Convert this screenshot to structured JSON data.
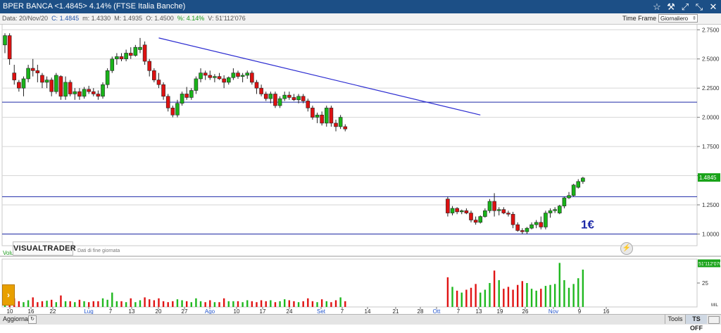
{
  "titlebar": {
    "title": "BPER BANCA <1.4845> 4.14%  (FTSE Italia Banche)",
    "icons": [
      "star-icon",
      "hammer-icon",
      "expand-icon",
      "collapse-icon",
      "close-icon"
    ]
  },
  "infobar": {
    "date": "Data: 20/Nov/20",
    "close": "C: 1.4845",
    "min": "m: 1.4330",
    "max": "M: 1.4935",
    "open": "O: 1.4500",
    "pct": "%: 4.14%",
    "volume": "V: 51'112'076",
    "timeframe_label": "Time Frame",
    "timeframe_value": "Giornaliero"
  },
  "watermark": {
    "brand": "VISUALTRADER",
    "sub": "Dati di fine giornata"
  },
  "statusbar": {
    "update": "Aggiorna",
    "tools": "Tools",
    "ts": "TS OFF"
  },
  "annotation": "1€",
  "chart_data": {
    "type": "candlestick",
    "price_axis": {
      "min": 0.9,
      "max": 2.8,
      "ticks": [
        2.75,
        2.5,
        2.25,
        2.0,
        1.75,
        1.5,
        1.25,
        1.0
      ],
      "tick_labels": [
        "2.7500",
        "2.5000",
        "2.2500",
        "2.0000",
        "1.7500",
        "1.5000",
        "1.2500",
        "1.0000"
      ]
    },
    "last_price_label": "1.4845",
    "date_labels": [
      "10",
      "16",
      "22",
      "Lug",
      "7",
      "13",
      "20",
      "27",
      "Ago",
      "10",
      "17",
      "24",
      "Set",
      "7",
      "14",
      "21",
      "28",
      "Ott",
      "7",
      "13",
      "19",
      "26",
      "Nov",
      "9",
      "16"
    ],
    "hlines": [
      2.13,
      1.32,
      1.0
    ],
    "trendline": {
      "from": {
        "bar": 33,
        "price": 2.68
      },
      "to": {
        "bar": 102,
        "price": 2.02
      }
    },
    "candles_segment_1": [
      [
        2.62,
        2.72,
        2.55,
        2.7
      ],
      [
        2.7,
        2.72,
        2.45,
        2.5
      ],
      [
        2.38,
        2.45,
        2.28,
        2.32
      ],
      [
        2.3,
        2.32,
        2.22,
        2.25
      ],
      [
        2.25,
        2.35,
        2.18,
        2.33
      ],
      [
        2.33,
        2.45,
        2.3,
        2.42
      ],
      [
        2.42,
        2.5,
        2.35,
        2.4
      ],
      [
        2.4,
        2.45,
        2.3,
        2.38
      ],
      [
        2.36,
        2.38,
        2.25,
        2.3
      ],
      [
        2.3,
        2.35,
        2.25,
        2.32
      ],
      [
        2.32,
        2.34,
        2.18,
        2.22
      ],
      [
        2.22,
        2.38,
        2.2,
        2.36
      ],
      [
        2.35,
        2.36,
        2.15,
        2.18
      ],
      [
        2.18,
        2.35,
        2.15,
        2.3
      ],
      [
        2.3,
        2.32,
        2.18,
        2.2
      ],
      [
        2.2,
        2.25,
        2.15,
        2.22
      ],
      [
        2.22,
        2.25,
        2.15,
        2.18
      ],
      [
        2.18,
        2.26,
        2.16,
        2.24
      ],
      [
        2.24,
        2.27,
        2.2,
        2.22
      ],
      [
        2.22,
        2.25,
        2.18,
        2.2
      ],
      [
        2.2,
        2.23,
        2.15,
        2.18
      ],
      [
        2.18,
        2.3,
        2.16,
        2.28
      ],
      [
        2.28,
        2.42,
        2.25,
        2.4
      ],
      [
        2.4,
        2.52,
        2.38,
        2.5
      ],
      [
        2.5,
        2.55,
        2.45,
        2.52
      ],
      [
        2.52,
        2.55,
        2.48,
        2.5
      ],
      [
        2.5,
        2.58,
        2.48,
        2.55
      ],
      [
        2.55,
        2.6,
        2.5,
        2.53
      ],
      [
        2.53,
        2.62,
        2.52,
        2.6
      ],
      [
        2.58,
        2.68,
        2.55,
        2.6
      ],
      [
        2.62,
        2.65,
        2.45,
        2.48
      ],
      [
        2.48,
        2.5,
        2.35,
        2.4
      ],
      [
        2.4,
        2.42,
        2.3,
        2.32
      ],
      [
        2.32,
        2.38,
        2.25,
        2.28
      ],
      [
        2.28,
        2.3,
        2.15,
        2.18
      ],
      [
        2.18,
        2.2,
        2.05,
        2.08
      ],
      [
        2.08,
        2.1,
        2.0,
        2.02
      ],
      [
        2.02,
        2.15,
        2.0,
        2.12
      ],
      [
        2.12,
        2.22,
        2.1,
        2.2
      ],
      [
        2.2,
        2.26,
        2.15,
        2.17
      ],
      [
        2.17,
        2.25,
        2.15,
        2.23
      ],
      [
        2.23,
        2.35,
        2.2,
        2.33
      ],
      [
        2.33,
        2.42,
        2.3,
        2.38
      ],
      [
        2.38,
        2.4,
        2.32,
        2.36
      ],
      [
        2.36,
        2.4,
        2.32,
        2.34
      ],
      [
        2.34,
        2.37,
        2.3,
        2.35
      ],
      [
        2.35,
        2.38,
        2.32,
        2.33
      ],
      [
        2.33,
        2.36,
        2.25,
        2.3
      ],
      [
        2.3,
        2.35,
        2.28,
        2.34
      ],
      [
        2.34,
        2.42,
        2.32,
        2.38
      ],
      [
        2.38,
        2.4,
        2.33,
        2.35
      ],
      [
        2.35,
        2.38,
        2.3,
        2.36
      ],
      [
        2.36,
        2.4,
        2.33,
        2.38
      ],
      [
        2.38,
        2.4,
        2.28,
        2.3
      ],
      [
        2.3,
        2.32,
        2.2,
        2.25
      ],
      [
        2.25,
        2.28,
        2.18,
        2.2
      ],
      [
        2.2,
        2.22,
        2.14,
        2.16
      ],
      [
        2.16,
        2.22,
        2.12,
        2.2
      ],
      [
        2.2,
        2.22,
        2.08,
        2.1
      ],
      [
        2.1,
        2.18,
        2.08,
        2.16
      ],
      [
        2.16,
        2.22,
        2.14,
        2.19
      ],
      [
        2.19,
        2.22,
        2.15,
        2.17
      ],
      [
        2.17,
        2.2,
        2.14,
        2.15
      ],
      [
        2.15,
        2.2,
        2.12,
        2.18
      ],
      [
        2.18,
        2.2,
        2.12,
        2.14
      ],
      [
        2.14,
        2.16,
        2.05,
        2.08
      ],
      [
        2.08,
        2.1,
        1.98,
        2.0
      ],
      [
        2.0,
        2.04,
        1.95,
        2.02
      ],
      [
        2.02,
        2.05,
        1.93,
        1.95
      ],
      [
        1.95,
        2.1,
        1.92,
        2.08
      ],
      [
        2.08,
        2.1,
        1.92,
        1.95
      ],
      [
        1.95,
        1.98,
        1.88,
        1.92
      ],
      [
        1.92,
        2.02,
        1.9,
        2.0
      ],
      [
        1.92,
        1.94,
        1.88,
        1.9
      ]
    ],
    "candles_segment_2": [
      [
        1.3,
        1.32,
        1.15,
        1.18
      ],
      [
        1.18,
        1.24,
        1.16,
        1.22
      ],
      [
        1.22,
        1.23,
        1.17,
        1.19
      ],
      [
        1.19,
        1.21,
        1.17,
        1.2
      ],
      [
        1.2,
        1.22,
        1.17,
        1.18
      ],
      [
        1.18,
        1.2,
        1.1,
        1.12
      ],
      [
        1.12,
        1.15,
        1.08,
        1.1
      ],
      [
        1.1,
        1.16,
        1.09,
        1.15
      ],
      [
        1.15,
        1.22,
        1.14,
        1.2
      ],
      [
        1.2,
        1.3,
        1.18,
        1.28
      ],
      [
        1.28,
        1.35,
        1.15,
        1.2
      ],
      [
        1.2,
        1.23,
        1.16,
        1.21
      ],
      [
        1.21,
        1.23,
        1.17,
        1.18
      ],
      [
        1.18,
        1.2,
        1.15,
        1.17
      ],
      [
        1.17,
        1.19,
        1.05,
        1.08
      ],
      [
        1.08,
        1.1,
        1.02,
        1.03
      ],
      [
        1.03,
        1.05,
        1.0,
        1.02
      ],
      [
        1.02,
        1.06,
        1.0,
        1.05
      ],
      [
        1.05,
        1.1,
        1.04,
        1.08
      ],
      [
        1.08,
        1.12,
        1.05,
        1.1
      ],
      [
        1.1,
        1.15,
        1.04,
        1.06
      ],
      [
        1.06,
        1.2,
        1.04,
        1.18
      ],
      [
        1.18,
        1.22,
        1.14,
        1.2
      ],
      [
        1.2,
        1.23,
        1.18,
        1.21
      ],
      [
        1.18,
        1.25,
        1.17,
        1.24
      ],
      [
        1.24,
        1.32,
        1.22,
        1.31
      ],
      [
        1.31,
        1.36,
        1.3,
        1.33
      ],
      [
        1.33,
        1.43,
        1.32,
        1.42
      ],
      [
        1.4,
        1.47,
        1.39,
        1.45
      ],
      [
        1.45,
        1.49,
        1.43,
        1.48
      ]
    ],
    "volume_bars": [
      0.15,
      0.2,
      0.18,
      0.12,
      0.1,
      0.14,
      0.2,
      0.1,
      0.12,
      0.13,
      0.15,
      0.1,
      0.24,
      0.12,
      0.12,
      0.1,
      0.15,
      0.12,
      0.1,
      0.12,
      0.12,
      0.18,
      0.15,
      0.3,
      0.12,
      0.12,
      0.1,
      0.18,
      0.1,
      0.14,
      0.2,
      0.16,
      0.14,
      0.18,
      0.12,
      0.1,
      0.12,
      0.16,
      0.14,
      0.12,
      0.1,
      0.18,
      0.12,
      0.1,
      0.14,
      0.1,
      0.1,
      0.18,
      0.12,
      0.12,
      0.12,
      0.1,
      0.14,
      0.12,
      0.1,
      0.14,
      0.12,
      0.14,
      0.1,
      0.12,
      0.16,
      0.14,
      0.12,
      0.1,
      0.12,
      0.18,
      0.12,
      0.1,
      0.16,
      0.12,
      0.1,
      0.14,
      0.2,
      0.12,
      0.62,
      0.42,
      0.34,
      0.3,
      0.36,
      0.4,
      0.48,
      0.3,
      0.36,
      0.5,
      0.76,
      0.56,
      0.38,
      0.42,
      0.36,
      0.46,
      0.54,
      0.5,
      0.38,
      0.34,
      0.38,
      0.44,
      0.46,
      0.48,
      0.92,
      0.56,
      0.4,
      0.48,
      0.6,
      0.78
    ],
    "volume_label": "Volume del titolo",
    "volume_ticks": [
      "25"
    ],
    "volume_last_label": "51'112'076",
    "volume_unit": "MIL"
  }
}
